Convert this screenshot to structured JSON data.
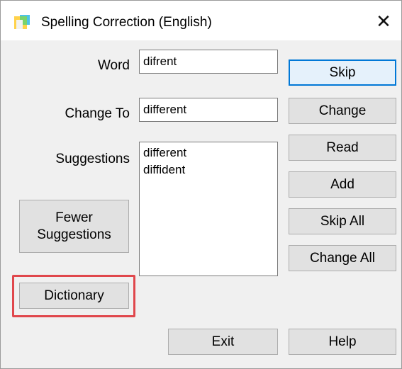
{
  "window": {
    "title": "Spelling Correction (English)",
    "close_glyph": "✕"
  },
  "fields": {
    "word_label": "Word",
    "word_value": "difrent",
    "change_to_label": "Change To",
    "change_to_value": "different",
    "suggestions_label": "Suggestions"
  },
  "suggestions": [
    "different",
    "diffident"
  ],
  "buttons": {
    "skip": "Skip",
    "change": "Change",
    "read": "Read",
    "add": "Add",
    "skip_all": "Skip All",
    "change_all": "Change All",
    "fewer_suggestions_line1": "Fewer",
    "fewer_suggestions_line2": "Suggestions",
    "dictionary": "Dictionary",
    "exit": "Exit",
    "help": "Help"
  },
  "colors": {
    "highlight": "#e0474c",
    "default_button_border": "#0078d7"
  }
}
